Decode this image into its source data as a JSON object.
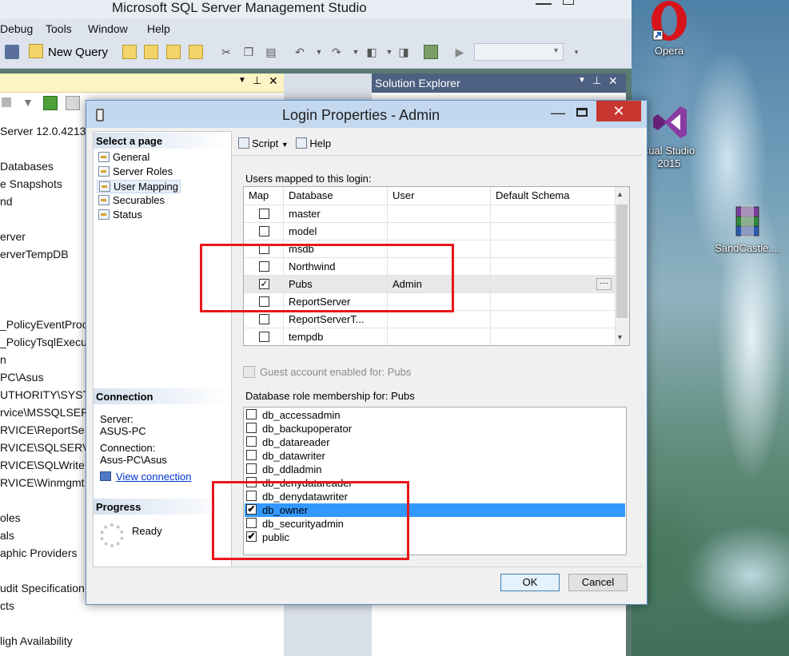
{
  "ssms": {
    "title": "Microsoft SQL Server Management Studio",
    "menu": [
      "Debug",
      "Tools",
      "Window",
      "Help"
    ],
    "new_query": "New Query",
    "object_explorer": {
      "items": [
        "Server 12.0.4213",
        "Databases",
        "e Snapshots",
        "nd",
        "erver",
        "erverTempDB",
        "_PolicyEventProc",
        "_PolicyTsqlExecu",
        "n",
        "PC\\Asus",
        "UTHORITY\\SYSTE",
        "rvice\\MSSQLSER",
        "RVICE\\ReportSe",
        "RVICE\\SQLSERV",
        "RVICE\\SQLWrite",
        "RVICE\\Winmgmt",
        "oles",
        "als",
        "aphic Providers",
        "udit Specification",
        "cts",
        "ligh Availability"
      ]
    },
    "solution_explorer_title": "Solution Explorer"
  },
  "desktop": {
    "icons": [
      {
        "label": "Opera",
        "icon": "opera-icon"
      },
      {
        "label": "sual Studio 2015",
        "icon": "visual-studio-icon"
      },
      {
        "label": "SandCastle....",
        "icon": "winrar-archive-icon"
      }
    ]
  },
  "dialog": {
    "title": "Login Properties - Admin",
    "select_page_header": "Select a page",
    "pages": [
      "General",
      "Server Roles",
      "User Mapping",
      "Securables",
      "Status"
    ],
    "selected_page": "User Mapping",
    "toolbar": {
      "script": "Script",
      "help": "Help"
    },
    "connection": {
      "header": "Connection",
      "server_label": "Server:",
      "server_value": "ASUS-PC",
      "connection_label": "Connection:",
      "connection_value": "Asus-PC\\Asus",
      "view_connection": "View connection"
    },
    "progress": {
      "header": "Progress",
      "status": "Ready"
    },
    "users_mapped_label": "Users mapped to this login:",
    "users_grid": {
      "columns": [
        "Map",
        "Database",
        "User",
        "Default Schema"
      ],
      "rows": [
        {
          "map": false,
          "database": "master",
          "user": "",
          "schema": ""
        },
        {
          "map": false,
          "database": "model",
          "user": "",
          "schema": ""
        },
        {
          "map": false,
          "database": "msdb",
          "user": "",
          "schema": ""
        },
        {
          "map": false,
          "database": "Northwind",
          "user": "",
          "schema": ""
        },
        {
          "map": true,
          "database": "Pubs",
          "user": "Admin",
          "schema": ""
        },
        {
          "map": false,
          "database": "ReportServer",
          "user": "",
          "schema": ""
        },
        {
          "map": false,
          "database": "ReportServerT...",
          "user": "",
          "schema": ""
        },
        {
          "map": false,
          "database": "tempdb",
          "user": "",
          "schema": ""
        }
      ]
    },
    "guest_account_label": "Guest account enabled for: Pubs",
    "role_membership_label": "Database role membership for: Pubs",
    "roles": [
      {
        "name": "db_accessadmin",
        "checked": false,
        "selected": false
      },
      {
        "name": "db_backupoperator",
        "checked": false,
        "selected": false
      },
      {
        "name": "db_datareader",
        "checked": false,
        "selected": false
      },
      {
        "name": "db_datawriter",
        "checked": false,
        "selected": false
      },
      {
        "name": "db_ddladmin",
        "checked": false,
        "selected": false
      },
      {
        "name": "db_denydatareader",
        "checked": false,
        "selected": false
      },
      {
        "name": "db_denydatawriter",
        "checked": false,
        "selected": false
      },
      {
        "name": "db_owner",
        "checked": true,
        "selected": true
      },
      {
        "name": "db_securityadmin",
        "checked": false,
        "selected": false
      },
      {
        "name": "public",
        "checked": true,
        "selected": false
      }
    ],
    "ok": "OK",
    "cancel": "Cancel",
    "ellipsis": "...."
  },
  "colors": {
    "selection": "#3399ff",
    "annotation": "#e8161b",
    "close_button": "#c7372f"
  }
}
